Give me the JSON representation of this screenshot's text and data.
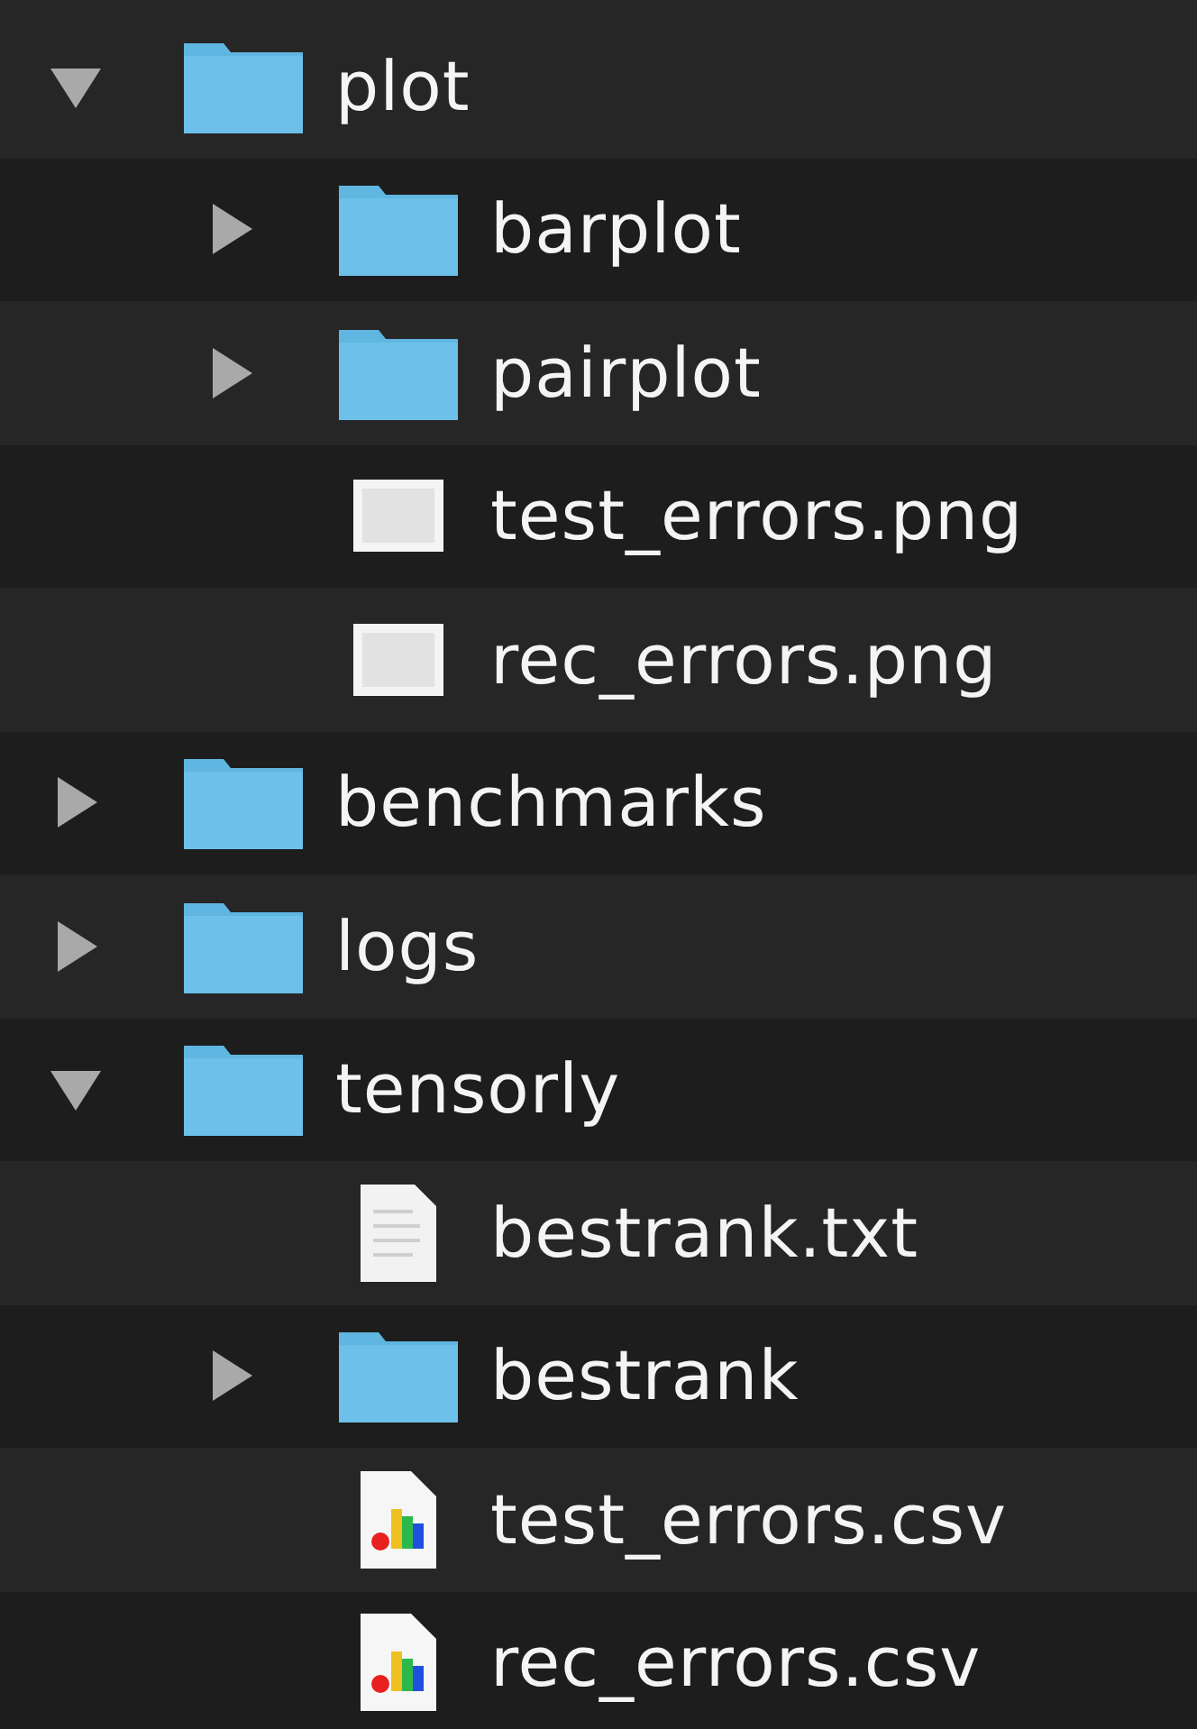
{
  "items": [
    {
      "name": "plot",
      "kind": "folder",
      "expanded": true,
      "children": [
        {
          "name": "barplot",
          "kind": "folder",
          "expanded": false
        },
        {
          "name": "pairplot",
          "kind": "folder",
          "expanded": false
        },
        {
          "name": "test_errors.png",
          "kind": "image"
        },
        {
          "name": "rec_errors.png",
          "kind": "image"
        }
      ]
    },
    {
      "name": "benchmarks",
      "kind": "folder",
      "expanded": false
    },
    {
      "name": "logs",
      "kind": "folder",
      "expanded": false
    },
    {
      "name": "tensorly",
      "kind": "folder",
      "expanded": true,
      "children": [
        {
          "name": "bestrank.txt",
          "kind": "text"
        },
        {
          "name": "bestrank",
          "kind": "folder",
          "expanded": false
        },
        {
          "name": "test_errors.csv",
          "kind": "chart"
        },
        {
          "name": "rec_errors.csv",
          "kind": "chart"
        }
      ]
    }
  ]
}
